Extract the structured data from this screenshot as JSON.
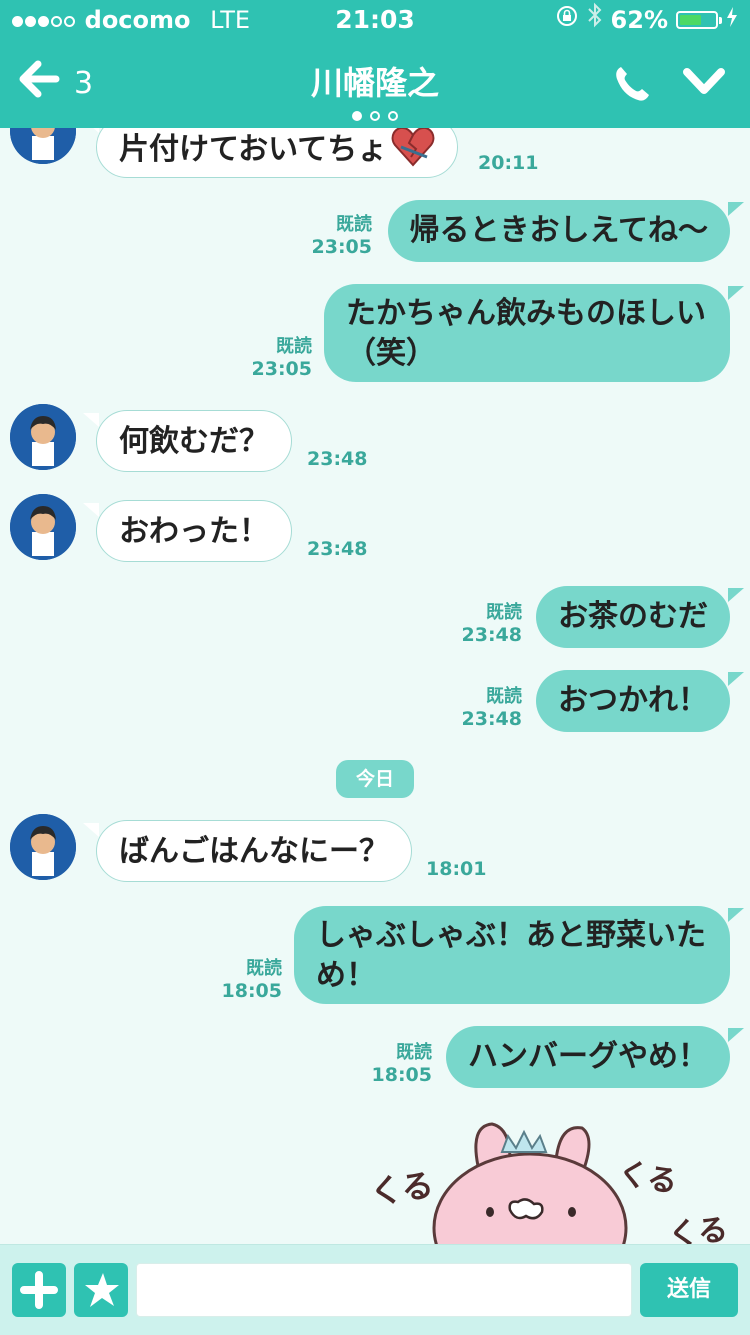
{
  "status_bar": {
    "carrier": "docomo",
    "network": "LTE",
    "time": "21:03",
    "battery_percent": "62%",
    "battery_level": 0.62,
    "battery_color": "#4cd964"
  },
  "nav": {
    "back_count": "3",
    "title": "川幡隆之",
    "page_indicator": {
      "count": 3,
      "active": 0
    }
  },
  "messages": [
    {
      "dir": "in",
      "text": "片付けておいてちょ",
      "time": "20:11",
      "icon": "broken-heart-emoji"
    },
    {
      "dir": "out",
      "read": "既読",
      "time": "23:05",
      "text": "帰るときおしえてね〜"
    },
    {
      "dir": "out",
      "read": "既読",
      "time": "23:05",
      "line1": "たかちゃん飲みものほしい",
      "line2": "（笑）"
    },
    {
      "dir": "in",
      "text": "何飲むだ？",
      "time": "23:48"
    },
    {
      "dir": "in",
      "text": "おわった！",
      "time": "23:48"
    },
    {
      "dir": "out",
      "read": "既読",
      "time": "23:48",
      "text": "お茶のむだ"
    },
    {
      "dir": "out",
      "read": "既読",
      "time": "23:48",
      "text": "おつかれ！"
    },
    {
      "dir": "in",
      "text": "ばんごはんなにー？",
      "time": "18:01"
    },
    {
      "dir": "out",
      "read": "既読",
      "time": "18:05",
      "line1": "しゃぶしゃぶ！あと野菜いた",
      "line2": "め！"
    },
    {
      "dir": "out",
      "read": "既読",
      "time": "18:05",
      "text": "ハンバーグやめ！"
    }
  ],
  "date_separator": "今日",
  "sticker": {
    "name": "pink-bunny-sticker",
    "text_left": "くる",
    "text_right1": "くる",
    "text_right2": "くる"
  },
  "input_bar": {
    "send_label": "送信",
    "plus_icon": "plus-icon",
    "sticker_icon": "star-icon"
  },
  "colors": {
    "header": "#2fc2b2",
    "outgoing": "#78d7cb",
    "background": "#eefaf8"
  }
}
